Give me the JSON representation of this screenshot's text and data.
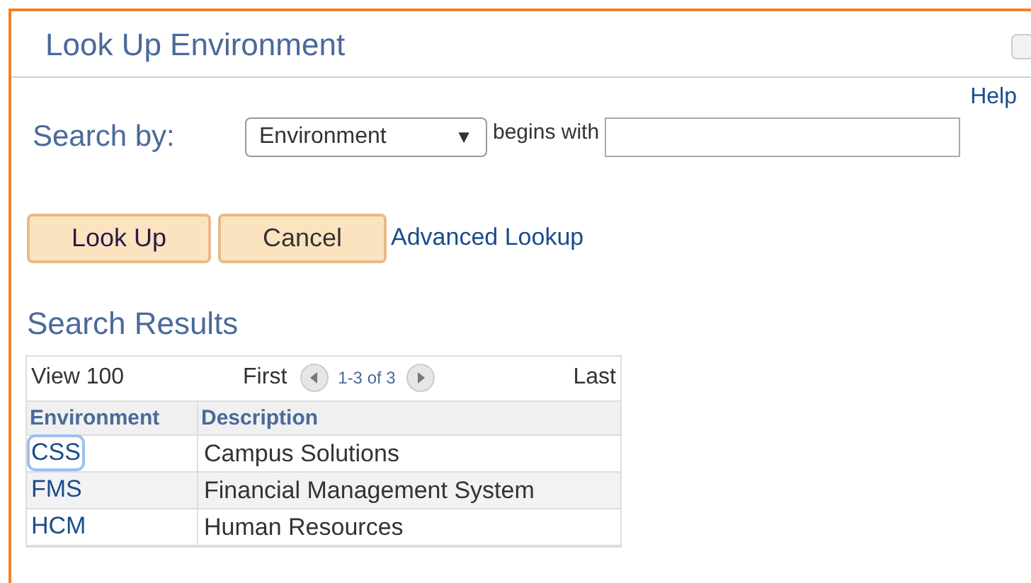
{
  "window": {
    "title": "Look Up Environment"
  },
  "help_link": "Help",
  "search": {
    "label": "Search by:",
    "field": "Environment",
    "arrow": "▼",
    "operator": "begins with"
  },
  "buttons": [
    "Look Up",
    "Cancel"
  ],
  "advanced_link": "Advanced Lookup",
  "results": {
    "title": "Search Results",
    "view": "View 100",
    "first": "First",
    "range": "1-3 of 3",
    "last": "Last",
    "columns": [
      "Environment",
      "Description"
    ],
    "rows": [
      {
        "code": "CSS",
        "description": "Campus Solutions",
        "focused": true
      },
      {
        "code": "FMS",
        "description": "Financial Management System",
        "focused": false
      },
      {
        "code": "HCM",
        "description": "Human Resources",
        "focused": false
      }
    ]
  }
}
